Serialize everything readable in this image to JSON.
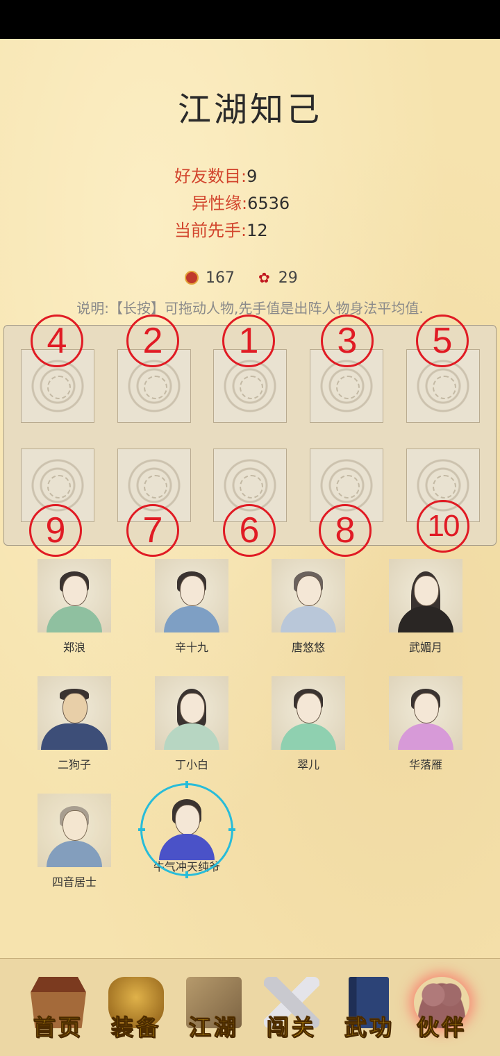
{
  "page_title": "江湖知己",
  "stats": {
    "friends_label": "好友数目:",
    "friends_value": "9",
    "affinity_label": "异性缘:",
    "affinity_value": "6536",
    "initiative_label": "当前先手:",
    "initiative_value": "12"
  },
  "currency": {
    "coin_value": "167",
    "rose_value": "29"
  },
  "instruction": "说明:【长按】可拖动人物,先手值是出阵人物身法平均值.",
  "formation": {
    "top_numbers": [
      "4",
      "2",
      "1",
      "3",
      "5"
    ],
    "bottom_numbers": [
      "9",
      "7",
      "6",
      "8",
      "10"
    ]
  },
  "characters": [
    {
      "name": "郑浪",
      "robe": "#8fc0a0"
    },
    {
      "name": "辛十九",
      "robe": "#7e9fc4"
    },
    {
      "name": "唐悠悠",
      "robe": "#b9c7d9"
    },
    {
      "name": "武媚月",
      "robe": "#2a2624"
    },
    {
      "name": "二狗子",
      "robe": "#3d4e78"
    },
    {
      "name": "丁小白",
      "robe": "#b7d6c2"
    },
    {
      "name": "翠儿",
      "robe": "#8fd0b0"
    },
    {
      "name": "华落雁",
      "robe": "#d79ad8"
    },
    {
      "name": "四音居士",
      "robe": "#6f93c0"
    },
    {
      "name": "牛气冲天纯爷",
      "robe": "#4a52c8"
    }
  ],
  "nav": [
    {
      "label": "首页",
      "icon": "house-icon"
    },
    {
      "label": "装备",
      "icon": "armor-icon"
    },
    {
      "label": "江湖",
      "icon": "scroll-map-icon"
    },
    {
      "label": "闯关",
      "icon": "crossed-swords-icon"
    },
    {
      "label": "武功",
      "icon": "book-icon"
    },
    {
      "label": "伙伴",
      "icon": "partners-icon"
    }
  ],
  "colors": {
    "accent_red": "#e01b24",
    "label_red": "#d2452d",
    "select_ring": "#28bcd9",
    "nav_gold": "#e5b012"
  }
}
